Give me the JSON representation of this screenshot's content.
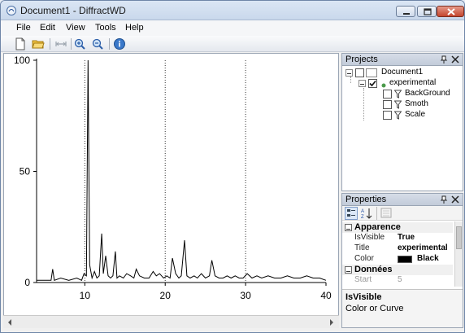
{
  "window": {
    "title": "Document1 - DiffractWD"
  },
  "menu": [
    "File",
    "Edit",
    "View",
    "Tools",
    "Help"
  ],
  "toolbar": {
    "icons": [
      "new-document-icon",
      "open-folder-icon",
      "fit-icon",
      "zoom-in-icon",
      "zoom-out-icon",
      "info-icon"
    ]
  },
  "chart": {
    "y_ticks": [
      "100",
      "50",
      "0"
    ],
    "x_ticks": [
      "10",
      "20",
      "30",
      "40"
    ]
  },
  "chart_data": {
    "type": "line",
    "xlim": [
      4,
      40
    ],
    "ylim": [
      0,
      100
    ],
    "grid": "vertical dotted lines at x = 10, 20, 30",
    "series": [
      {
        "color": "#000000",
        "x": [
          4.0,
          5.0,
          5.8,
          6.0,
          6.2,
          7.0,
          8.0,
          9.0,
          9.6,
          9.9,
          10.2,
          10.4,
          10.6,
          10.9,
          11.2,
          11.5,
          11.8,
          12.1,
          12.3,
          12.6,
          12.9,
          13.2,
          13.5,
          13.8,
          14.0,
          14.3,
          14.8,
          15.2,
          15.7,
          16.1,
          16.4,
          16.8,
          17.4,
          18.0,
          18.5,
          18.9,
          19.3,
          19.8,
          20.2,
          20.6,
          20.9,
          21.3,
          21.7,
          22.0,
          22.4,
          22.7,
          23.1,
          23.6,
          24.0,
          24.5,
          25.0,
          25.5,
          25.8,
          26.2,
          26.7,
          27.2,
          27.7,
          28.2,
          28.7,
          29.2,
          29.7,
          30.2,
          30.8,
          31.4,
          32.0,
          32.8,
          33.6,
          34.4,
          35.2,
          36.0,
          36.8,
          37.6,
          38.4,
          39.2,
          40.0
        ],
        "values": [
          1,
          1,
          1,
          6,
          1,
          2,
          1,
          2,
          1,
          4,
          3,
          100,
          8,
          2,
          5,
          2,
          3,
          22,
          4,
          12,
          3,
          2,
          3,
          14,
          2,
          3,
          2,
          4,
          3,
          2,
          6,
          3,
          2,
          2,
          5,
          3,
          4,
          2,
          3,
          2,
          11,
          4,
          2,
          3,
          19,
          3,
          2,
          3,
          2,
          4,
          2,
          3,
          10,
          3,
          2,
          2,
          3,
          2,
          3,
          2,
          2,
          4,
          2,
          3,
          2,
          3,
          2,
          2,
          3,
          2,
          2,
          3,
          2,
          2,
          1
        ]
      }
    ]
  },
  "projects": {
    "title": "Projects",
    "tree": [
      {
        "label": "Document1",
        "level": 0,
        "checked": false
      },
      {
        "label": "experimental",
        "level": 1,
        "checked": true
      },
      {
        "label": "BackGround",
        "level": 2,
        "checked": false
      },
      {
        "label": "Smoth",
        "level": 2,
        "checked": false
      },
      {
        "label": "Scale",
        "level": 2,
        "checked": false
      }
    ]
  },
  "properties": {
    "title": "Properties",
    "cat1": "Apparence",
    "rows": [
      {
        "key": "IsVisible",
        "value": "True"
      },
      {
        "key": "Title",
        "value": "experimental"
      },
      {
        "key": "Color",
        "value": "Black"
      }
    ],
    "color_swatch": "#000000",
    "cat2": "Données",
    "start_key": "Start",
    "start_value": "5",
    "description_title": "IsVisible",
    "description_text": "Color or Curve"
  }
}
